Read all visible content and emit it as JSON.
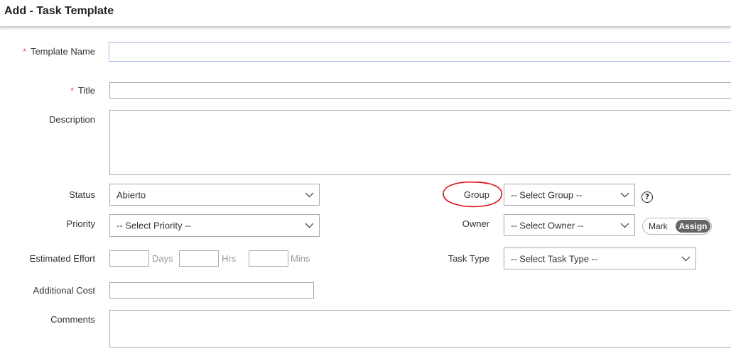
{
  "header": {
    "title": "Add - Task Template"
  },
  "form": {
    "required_marker": "*",
    "template_name": {
      "label": "Template Name",
      "value": ""
    },
    "title": {
      "label": "Title",
      "value": ""
    },
    "description": {
      "label": "Description",
      "value": ""
    },
    "status": {
      "label": "Status",
      "selected": "Abierto"
    },
    "group": {
      "label": "Group",
      "selected": "-- Select Group --"
    },
    "priority": {
      "label": "Priority",
      "selected": "-- Select Priority --"
    },
    "owner": {
      "label": "Owner",
      "selected": "-- Select Owner --"
    },
    "owner_toggle": {
      "mark_label": "Mark",
      "assign_label": "Assign",
      "active": "Assign"
    },
    "estimated_effort": {
      "label": "Estimated Effort",
      "days_unit": "Days",
      "hrs_unit": "Hrs",
      "mins_unit": "Mins"
    },
    "task_type": {
      "label": "Task Type",
      "selected": "-- Select Task Type --"
    },
    "additional_cost": {
      "label": "Additional Cost",
      "value": ""
    },
    "comments": {
      "label": "Comments",
      "value": ""
    },
    "help_glyph": "?"
  },
  "icons": {
    "dropdown": "chevron-down-icon",
    "help": "help-icon",
    "annotation": "red-circle-annotation"
  },
  "colors": {
    "required": "#d9534f",
    "annotation": "#e0101e",
    "toggle_active": "#666666",
    "focus_border": "#a4b4e8"
  }
}
